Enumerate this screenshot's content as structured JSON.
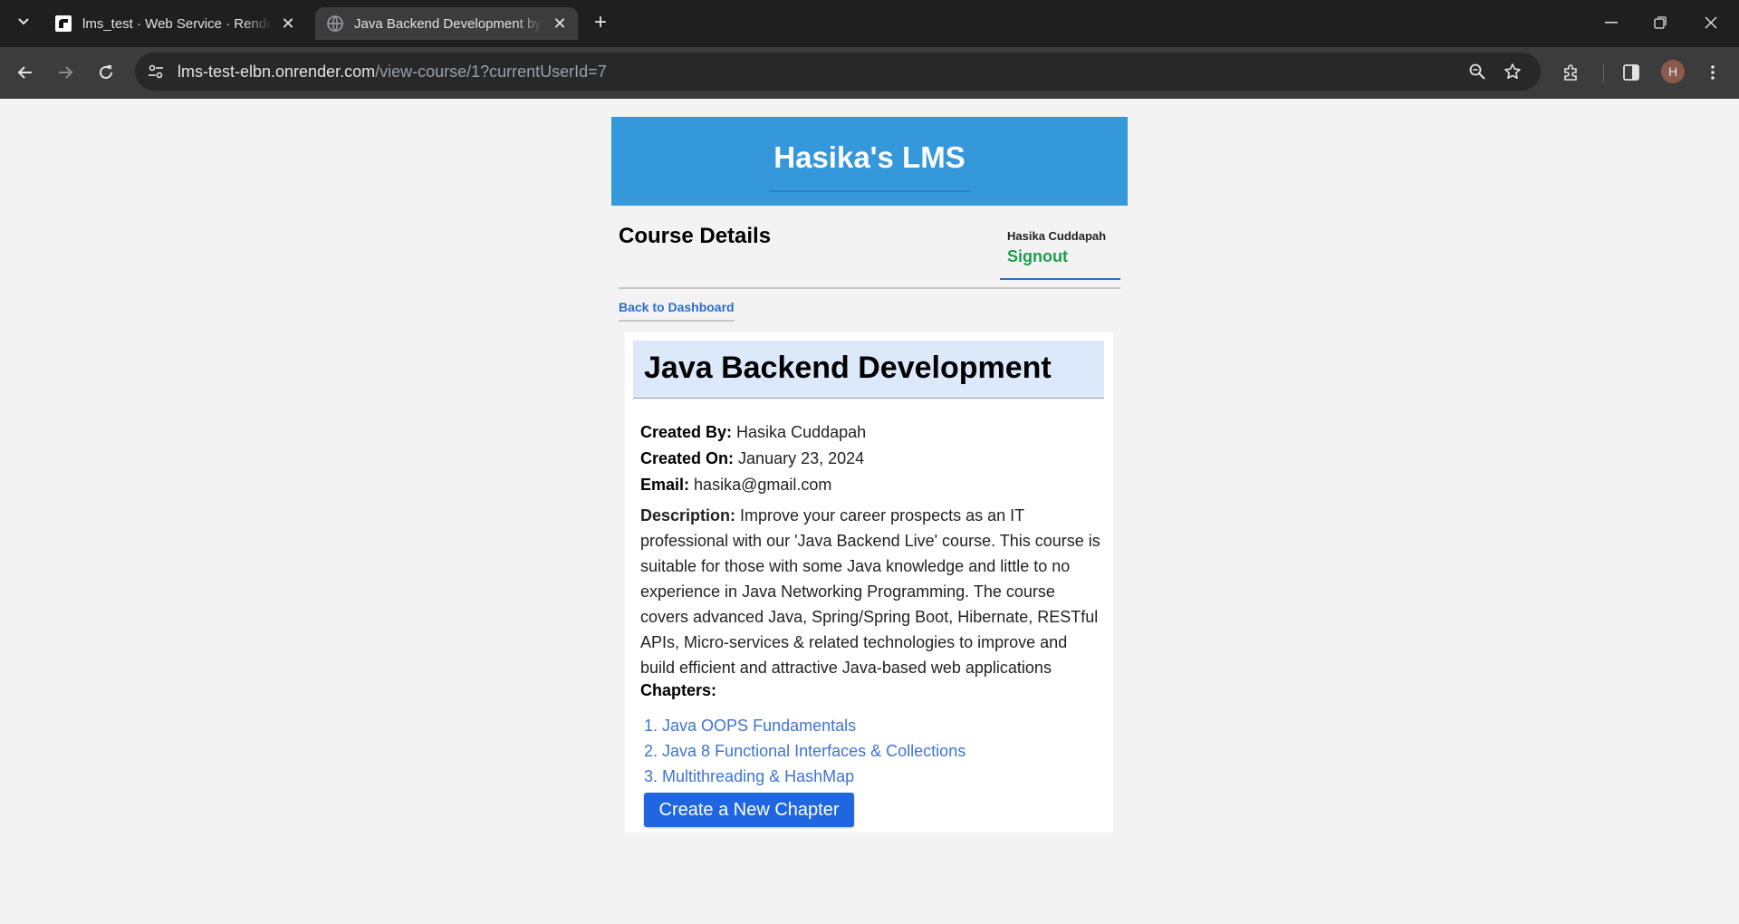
{
  "browser": {
    "tabs": [
      {
        "title": "lms_test · Web Service · Render Dashboard",
        "active": false
      },
      {
        "title": "Java Backend Development by Hasika",
        "active": true
      }
    ],
    "url_host": "lms-test-elbn.onrender.com",
    "url_path": "/view-course/1?currentUserId=7",
    "profile_initial": "H"
  },
  "site": {
    "brand": "Hasika's LMS"
  },
  "page": {
    "heading": "Course Details",
    "user_name": "Hasika Cuddapah",
    "signout": "Signout",
    "back_link": "Back to Dashboard"
  },
  "course": {
    "title": "Java Backend Development",
    "created_by_label": "Created By:",
    "created_by": "Hasika Cuddapah",
    "created_on_label": "Created On:",
    "created_on": "January 23, 2024",
    "email_label": "Email:",
    "email": "hasika@gmail.com",
    "description_label": "Description:",
    "description": "Improve your career prospects as an IT professional with our 'Java Backend Live' course. This course is suitable for those with some Java knowledge and little to no experience in Java Networking Programming. The course covers advanced Java, Spring/Spring Boot, Hibernate, RESTful APIs, Micro-services & related technologies to improve and build efficient and attractive Java-based web applications",
    "chapters_label": "Chapters:",
    "chapters": [
      {
        "number": "1.",
        "title": "Java OOPS Fundamentals"
      },
      {
        "number": "2.",
        "title": "Java 8 Functional Interfaces & Collections"
      },
      {
        "number": "3.",
        "title": "Multithreading & HashMap"
      }
    ],
    "create_button": "Create a New Chapter"
  }
}
